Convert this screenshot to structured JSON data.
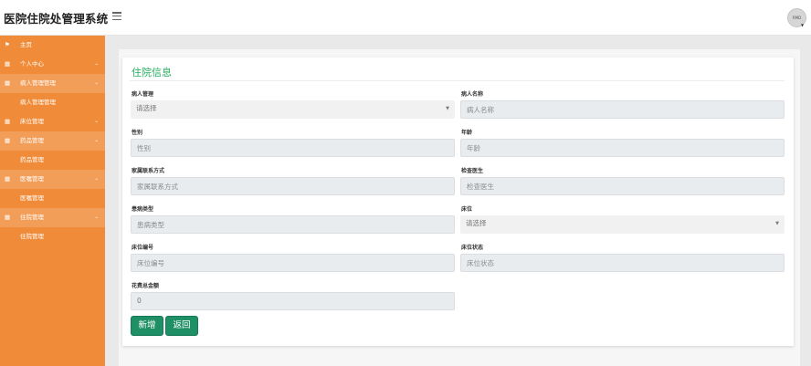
{
  "header": {
    "app_title": "医院住院处管理系统",
    "avatar_text": "RMD"
  },
  "sidebar": {
    "items": [
      {
        "label": "主页",
        "icon": "flag-icon",
        "caret": ""
      },
      {
        "label": "个人中心",
        "icon": "grid-icon",
        "caret": "⌄"
      },
      {
        "label": "病人管理管理",
        "icon": "grid-icon",
        "caret": "⌄"
      },
      {
        "label": "病人管理管理",
        "icon": "",
        "caret": ""
      },
      {
        "label": "床位管理",
        "icon": "grid-icon",
        "caret": "⌄"
      },
      {
        "label": "药品管理",
        "icon": "grid-icon",
        "caret": "⌄"
      },
      {
        "label": "药品管理",
        "icon": "",
        "caret": ""
      },
      {
        "label": "医嘱管理",
        "icon": "grid-icon",
        "caret": "⌄"
      },
      {
        "label": "医嘱管理",
        "icon": "",
        "caret": ""
      },
      {
        "label": "住院管理",
        "icon": "grid-icon",
        "caret": "⌄"
      },
      {
        "label": "住院管理",
        "icon": "",
        "caret": ""
      }
    ]
  },
  "form": {
    "title": "住院信息",
    "fields": {
      "patient_manage": {
        "label": "病人管理",
        "placeholder": "请选择"
      },
      "patient_name": {
        "label": "病人名称",
        "placeholder": "病人名称"
      },
      "gender": {
        "label": "性别",
        "placeholder": "性别"
      },
      "age": {
        "label": "年龄",
        "placeholder": "年龄"
      },
      "family_contact": {
        "label": "家属联系方式",
        "placeholder": "家属联系方式"
      },
      "exam_doctor": {
        "label": "检查医生",
        "placeholder": "检查医生"
      },
      "disease_type": {
        "label": "患病类型",
        "placeholder": "患病类型"
      },
      "bed": {
        "label": "床位",
        "placeholder": "请选择"
      },
      "bed_number": {
        "label": "床位编号",
        "placeholder": "床位编号"
      },
      "bed_status": {
        "label": "床位状态",
        "placeholder": "床位状态"
      },
      "total_cost": {
        "label": "花费总金额",
        "value": "0"
      }
    },
    "buttons": {
      "add": "新增",
      "back": "返回"
    }
  },
  "colors": {
    "sidebar": "#f08c39",
    "accent_green": "#27ae60",
    "button_green": "#1f8f66"
  }
}
